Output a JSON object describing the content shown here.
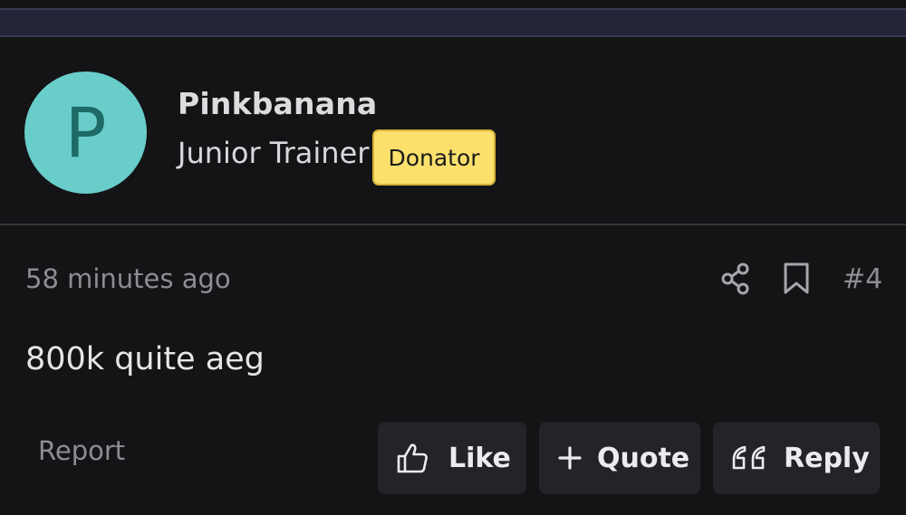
{
  "user": {
    "avatar_letter": "P",
    "avatar_color": "#69cdc9",
    "name": "Pinkbanana",
    "title": "Junior Trainer",
    "badge": "Donator",
    "badge_color": "#fbe06c"
  },
  "post": {
    "timestamp": "58 minutes ago",
    "share_icon": "share-icon",
    "bookmark_icon": "bookmark-icon",
    "number": "#4",
    "message": "800k quite aeg"
  },
  "actions": {
    "report_label": "Report",
    "like_label": "Like",
    "like_icon": "thumbs-up-icon",
    "quote_label": "Quote",
    "quote_icon": "plus-icon",
    "reply_label": "Reply",
    "reply_icon": "quote-marks-icon"
  }
}
